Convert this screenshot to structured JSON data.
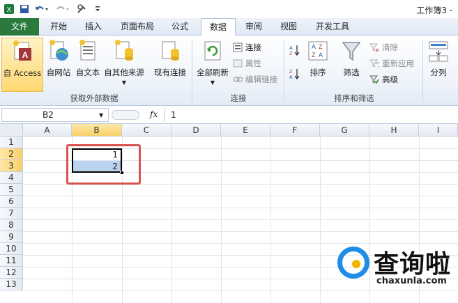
{
  "window": {
    "title": "工作簿3 -"
  },
  "quick_access": {
    "save_icon": "save-icon",
    "undo_icon": "undo-icon",
    "redo_icon": "redo-icon",
    "customize_icon": "customize-icon"
  },
  "tabs": [
    {
      "label": "文件"
    },
    {
      "label": "开始"
    },
    {
      "label": "插入"
    },
    {
      "label": "页面布局"
    },
    {
      "label": "公式"
    },
    {
      "label": "数据"
    },
    {
      "label": "审阅"
    },
    {
      "label": "视图"
    },
    {
      "label": "开发工具"
    }
  ],
  "active_tab": "数据",
  "ribbon": {
    "get_external": {
      "label": "获取外部数据",
      "access": "自 Access",
      "web": "自网站",
      "text": "自文本",
      "other": "自其他来源",
      "existing": "现有连接"
    },
    "connections": {
      "label": "连接",
      "refresh_all": "全部刷新",
      "connections": "连接",
      "properties": "属性",
      "edit_links": "编辑链接"
    },
    "sort_filter": {
      "label": "排序和筛选",
      "sort": "排序",
      "filter": "筛选",
      "clear": "清除",
      "reapply": "重新应用",
      "advanced": "高级"
    },
    "tools": {
      "split": "分列"
    }
  },
  "formula_bar": {
    "name_box": "B2",
    "fx": "fx",
    "value": "1"
  },
  "grid": {
    "columns": [
      "A",
      "B",
      "C",
      "D",
      "E",
      "F",
      "G",
      "H",
      "I"
    ],
    "rows": [
      "1",
      "2",
      "3",
      "4",
      "5",
      "6",
      "7",
      "8",
      "9",
      "10",
      "11",
      "12",
      "13"
    ],
    "cells": {
      "B2": "1",
      "B3": "2"
    },
    "selection": "B2:B3",
    "accent": "#d9534f"
  },
  "watermark": {
    "name": "查询啦",
    "url": "chaxunla.com"
  }
}
